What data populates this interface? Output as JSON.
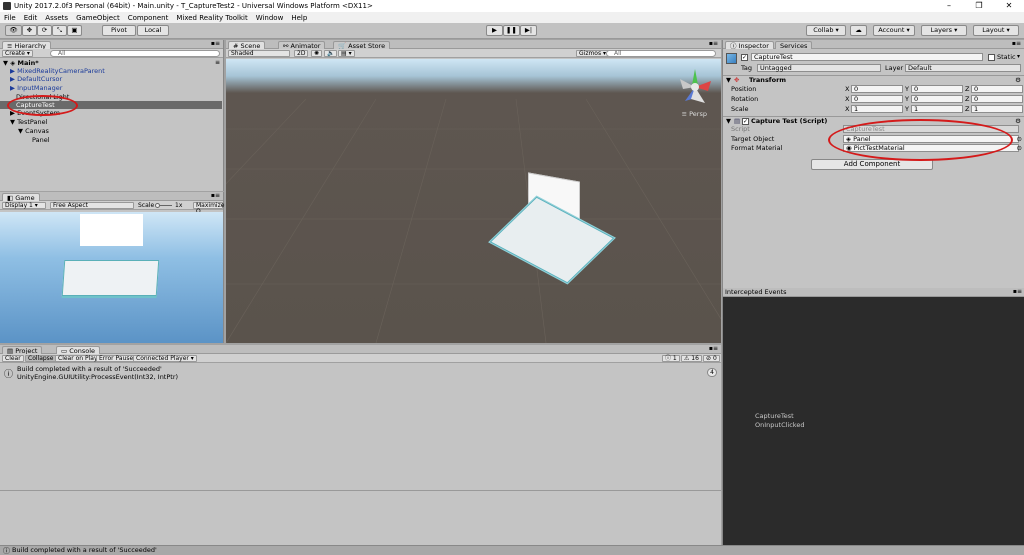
{
  "window": {
    "title": "Unity 2017.2.0f3 Personal (64bit) - Main.unity - T_CaptureTest2 - Universal Windows Platform <DX11>",
    "controls": [
      "–",
      "❐",
      "✕"
    ]
  },
  "menu": [
    "File",
    "Edit",
    "Assets",
    "GameObject",
    "Component",
    "Mixed Reality Toolkit",
    "Window",
    "Help"
  ],
  "toolbar": {
    "pivot": "Pivot",
    "local": "Local",
    "collab": "Collab ▾",
    "account": "Account ▾",
    "layers": "Layers",
    "layout": "Layout"
  },
  "hierarchy": {
    "tab": "Hierarchy",
    "create": "Create ▾",
    "search_placeholder": "All",
    "scene": "Main*",
    "items": [
      {
        "label": "MixedRealityCameraParent"
      },
      {
        "label": "DefaultCursor"
      },
      {
        "label": "InputManager"
      },
      {
        "label": "Directional Light"
      },
      {
        "label": "CaptureTest"
      },
      {
        "label": "EventSystem"
      },
      {
        "label": "TestPanel"
      },
      {
        "label": "Canvas"
      },
      {
        "label": "Panel"
      }
    ]
  },
  "game": {
    "tab": "Game",
    "display": "Display 1",
    "aspect": "Free Aspect",
    "scale_label": "Scale",
    "scale_value": "1x",
    "maximize": "Maximize O"
  },
  "scene_view": {
    "tabs": [
      "Scene",
      "Animator",
      "Asset Store"
    ],
    "shaded": "Shaded",
    "mode_2d": "2D",
    "gizmos": "Gizmos ▾",
    "search_placeholder": "All",
    "persp": "≡ Persp"
  },
  "inspector": {
    "tabs": [
      "Inspector",
      "Services"
    ],
    "object_name": "CaptureTest",
    "static_label": "Static",
    "tag_label": "Tag",
    "tag_value": "Untagged",
    "layer_label": "Layer",
    "layer_value": "Default",
    "transform": {
      "title": "Transform",
      "rows": [
        {
          "label": "Position",
          "x": "0",
          "y": "0",
          "z": "0"
        },
        {
          "label": "Rotation",
          "x": "0",
          "y": "0",
          "z": "0"
        },
        {
          "label": "Scale",
          "x": "1",
          "y": "1",
          "z": "1"
        }
      ]
    },
    "script_component": {
      "title": "Capture Test (Script)",
      "script_label": "Script",
      "script_value": "CaptureTest",
      "target_label": "Target Object",
      "target_value": "Panel",
      "material_label": "Format Material",
      "material_value": "PictTestMaterial"
    },
    "add_component": "Add Component"
  },
  "intercepted": {
    "title": "Intercepted Events",
    "line1": "CaptureTest",
    "line2": "OnInputClicked"
  },
  "console": {
    "tabs": [
      "Project",
      "Console"
    ],
    "buttons": [
      "Clear",
      "Collapse",
      "Clear on Play",
      "Error Pause",
      "Connected Player ▾"
    ],
    "counts": {
      "info": "1",
      "warn": "16",
      "error": "0"
    },
    "entry_line1": "Build completed with a result of 'Succeeded'",
    "entry_line2": "UnityEngine.GUIUtility:ProcessEvent(Int32, IntPtr)",
    "entry_count": "4"
  },
  "status": {
    "text": "Build completed with a result of 'Succeeded'"
  }
}
